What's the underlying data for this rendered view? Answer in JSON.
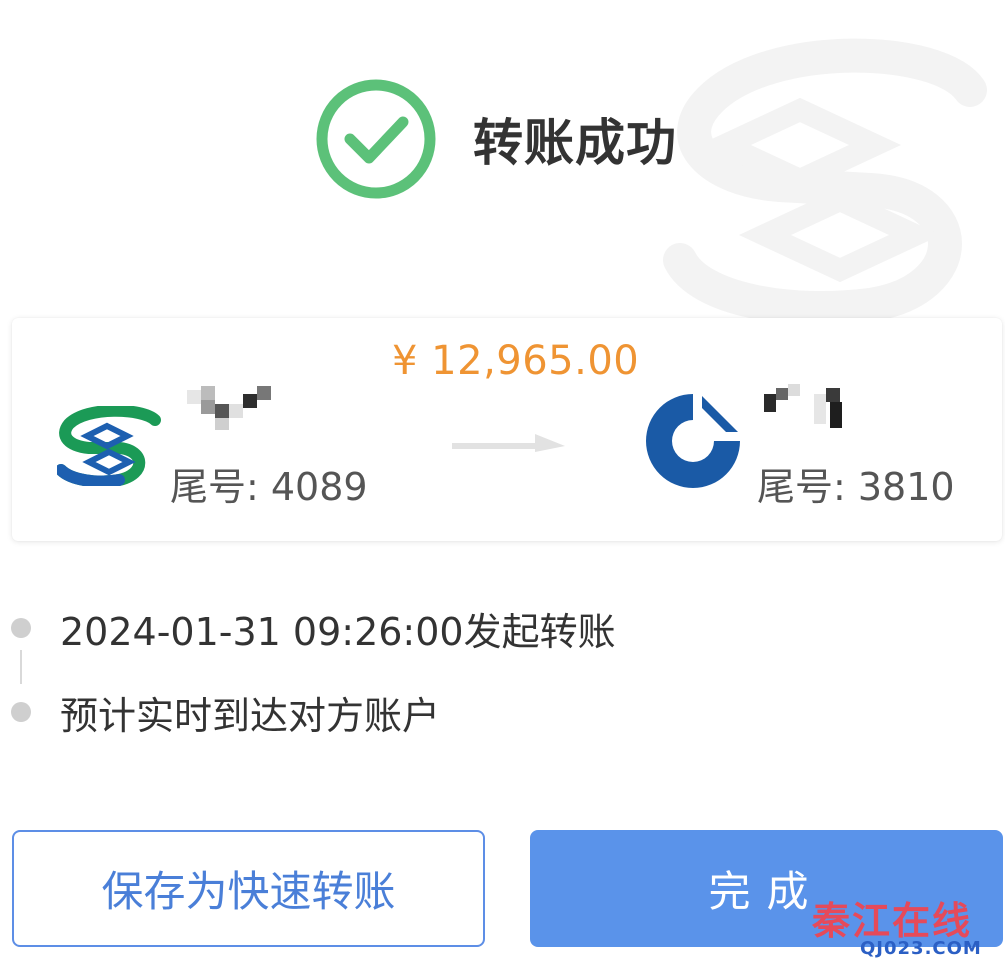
{
  "header": {
    "title": "转账成功",
    "icon": "check-circle-icon",
    "icon_color": "#5cc179"
  },
  "transfer": {
    "amount": "¥ 12,965.00",
    "amount_color": "#ef9433",
    "from": {
      "bank_logo": "cmsb-bank-logo",
      "tail_label": "尾号: 4089"
    },
    "to": {
      "bank_logo": "ccb-bank-logo",
      "tail_label": "尾号: 3810"
    },
    "arrow_icon": "arrow-right-icon"
  },
  "timeline": [
    {
      "text": "2024-01-31 09:26:00发起转账"
    },
    {
      "text": "预计实时到达对方账户"
    }
  ],
  "actions": {
    "save_label": "保存为快速转账",
    "done_label": "完成",
    "primary_color": "#5a93ea"
  },
  "site_watermark": {
    "name": "秦江在线",
    "url": "QJ023.COM"
  }
}
